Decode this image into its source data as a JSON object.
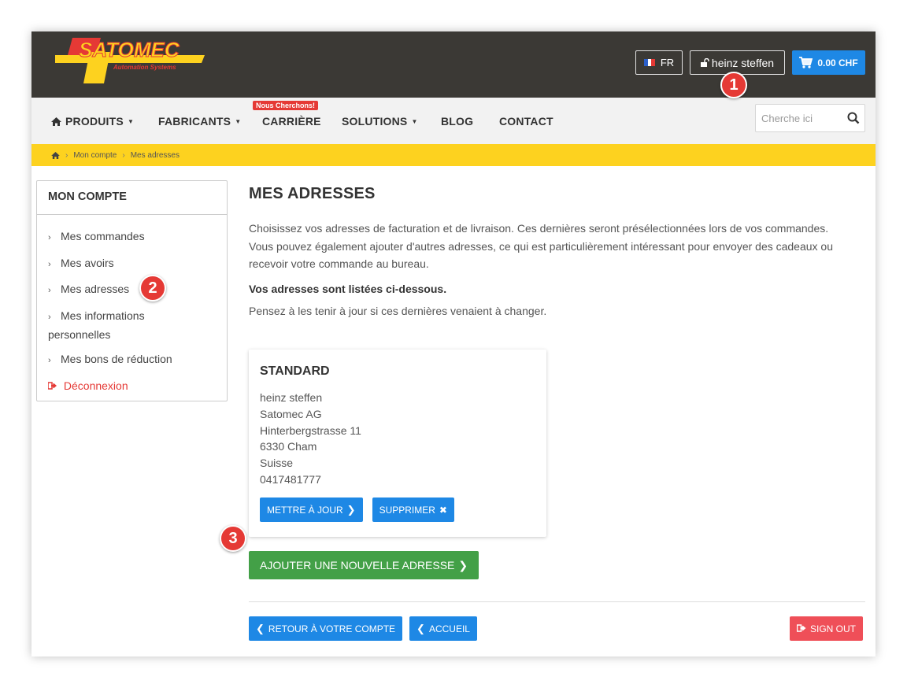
{
  "header": {
    "logo_text": "SATOMEC",
    "logo_tagline": "Automation Systems",
    "language": "FR",
    "account_name": "heinz steffen",
    "cart_total": "0.00 CHF"
  },
  "nav": {
    "items": [
      {
        "label": "PRODUITS",
        "dropdown": true
      },
      {
        "label": "FABRICANTS",
        "dropdown": true
      },
      {
        "label": "CARRIÈRE",
        "dropdown": false
      },
      {
        "label": "SOLUTIONS",
        "dropdown": true
      },
      {
        "label": "BLOG",
        "dropdown": false
      },
      {
        "label": "CONTACT",
        "dropdown": false
      }
    ],
    "careers_badge": "Nous Cherchons!",
    "search_placeholder": "Cherche ici"
  },
  "breadcrumb": [
    "Mon compte",
    "Mes adresses"
  ],
  "sidebar": {
    "title": "MON COMPTE",
    "items": [
      "Mes commandes",
      "Mes avoirs",
      "Mes adresses",
      "Mes informations personnelles",
      "Mes bons de réduction"
    ],
    "logout": "Déconnexion"
  },
  "main": {
    "title": "MES ADRESSES",
    "intro": "Choisissez vos adresses de facturation et de livraison. Ces dernières seront présélectionnées lors de vos commandes. Vous pouvez également ajouter d'autres adresses, ce qui est particulièrement intéressant pour envoyer des cadeaux ou recevoir votre commande au bureau.",
    "listed_note": "Vos adresses sont listées ci-dessous.",
    "update_note": "Pensez à les tenir à jour si ces dernières venaient à changer.",
    "address": {
      "title": "STANDARD",
      "lines": [
        "heinz steffen",
        "Satomec AG",
        "Hinterbergstrasse 11",
        "6330 Cham",
        "Suisse",
        "0417481777"
      ],
      "update_button": "METTRE À JOUR",
      "delete_button": "SUPPRIMER"
    },
    "add_button": "AJOUTER UNE NOUVELLE ADRESSE",
    "back_button": "RETOUR À VOTRE COMPTE",
    "home_button": "ACCUEIL",
    "signout_button": "SIGN OUT"
  },
  "annotations": [
    "1",
    "2",
    "3"
  ],
  "colors": {
    "header_bg": "#3b3935",
    "accent_blue": "#1e88e5",
    "yellow": "#fdd21f",
    "green": "#43a047",
    "red": "#e53935"
  }
}
